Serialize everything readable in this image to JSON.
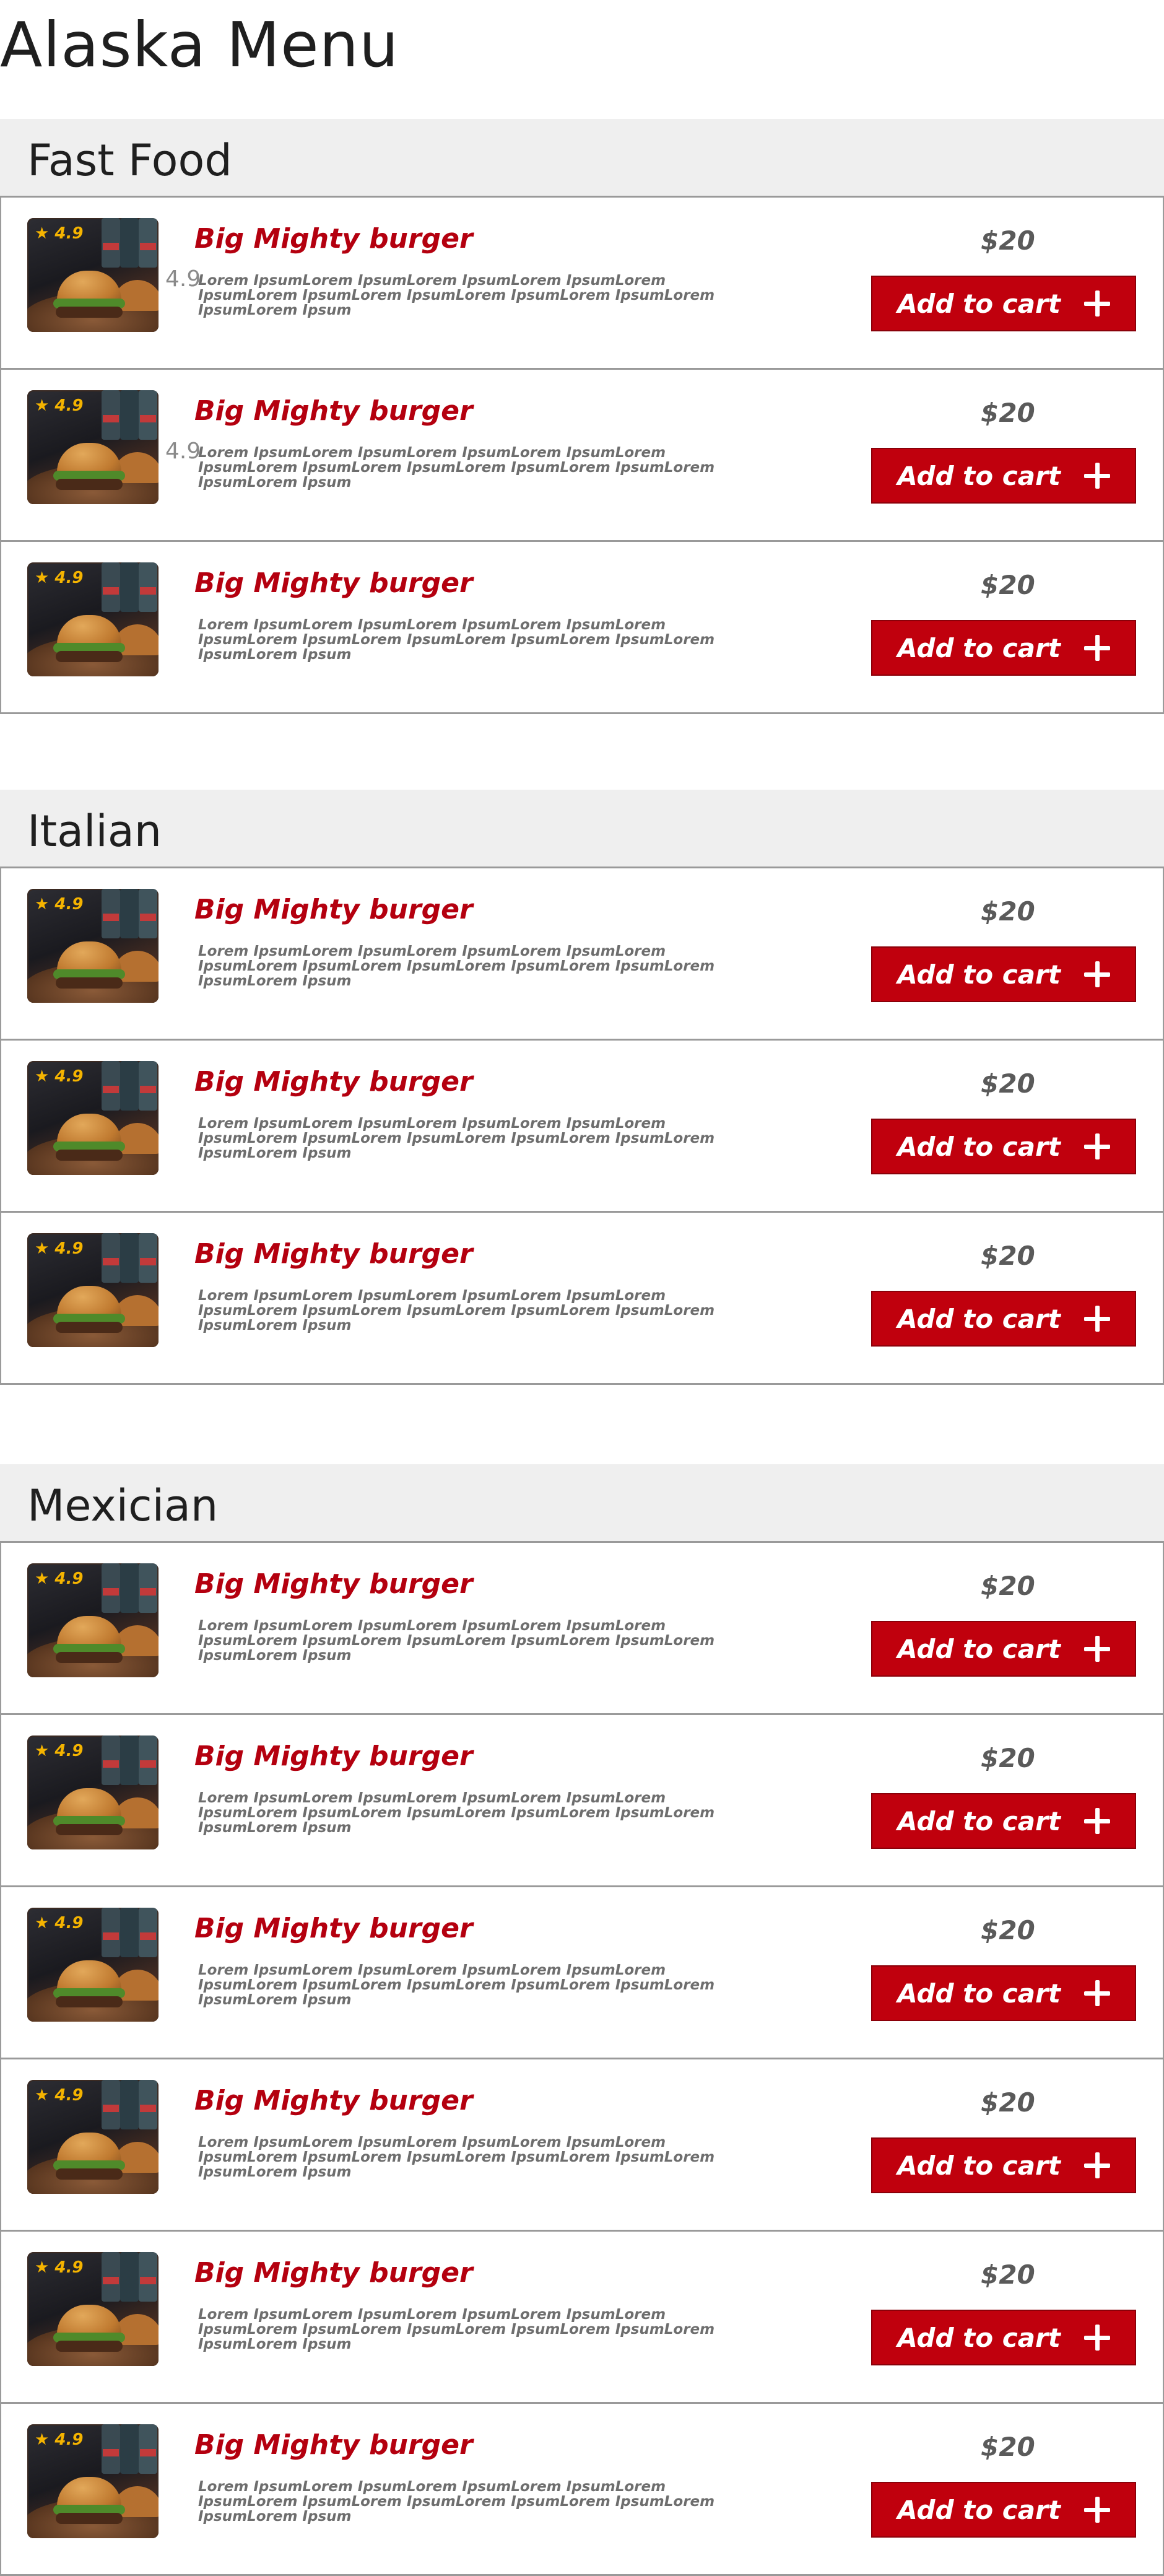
{
  "page": {
    "title": "Alaska Menu"
  },
  "colors": {
    "accent": "#c0000d",
    "name": "#b4000f",
    "rating": "#f5b400",
    "section_bg": "#efefef"
  },
  "sections": [
    {
      "title": "Fast Food",
      "items": [
        {
          "rating": "4.9",
          "extra_rating": "4.9",
          "name": "Big Mighty burger",
          "description": "Lorem IpsumLorem IpsumLorem IpsumLorem IpsumLorem IpsumLorem IpsumLorem IpsumLorem IpsumLorem IpsumLorem IpsumLorem Ipsum",
          "price": "$20",
          "button": "Add to cart",
          "image": "burger-photo"
        },
        {
          "rating": "4.9",
          "extra_rating": "4.9",
          "name": "Big Mighty burger",
          "description": "Lorem IpsumLorem IpsumLorem IpsumLorem IpsumLorem IpsumLorem IpsumLorem IpsumLorem IpsumLorem IpsumLorem IpsumLorem Ipsum",
          "price": "$20",
          "button": "Add to cart",
          "image": "burger-photo"
        },
        {
          "rating": "4.9",
          "name": "Big Mighty burger",
          "description": "Lorem IpsumLorem IpsumLorem IpsumLorem IpsumLorem IpsumLorem IpsumLorem IpsumLorem IpsumLorem IpsumLorem IpsumLorem Ipsum",
          "price": "$20",
          "button": "Add to cart",
          "image": "burger-photo"
        }
      ]
    },
    {
      "title": "Italian",
      "items": [
        {
          "rating": "4.9",
          "name": "Big Mighty burger",
          "description": "Lorem IpsumLorem IpsumLorem IpsumLorem IpsumLorem IpsumLorem IpsumLorem IpsumLorem IpsumLorem IpsumLorem IpsumLorem Ipsum",
          "price": "$20",
          "button": "Add to cart",
          "image": "burger-photo"
        },
        {
          "rating": "4.9",
          "name": "Big Mighty burger",
          "description": "Lorem IpsumLorem IpsumLorem IpsumLorem IpsumLorem IpsumLorem IpsumLorem IpsumLorem IpsumLorem IpsumLorem IpsumLorem Ipsum",
          "price": "$20",
          "button": "Add to cart",
          "image": "burger-photo"
        },
        {
          "rating": "4.9",
          "name": "Big Mighty burger",
          "description": "Lorem IpsumLorem IpsumLorem IpsumLorem IpsumLorem IpsumLorem IpsumLorem IpsumLorem IpsumLorem IpsumLorem IpsumLorem Ipsum",
          "price": "$20",
          "button": "Add to cart",
          "image": "burger-photo"
        }
      ]
    },
    {
      "title": "Mexician",
      "items": [
        {
          "rating": "4.9",
          "name": "Big Mighty burger",
          "description": "Lorem IpsumLorem IpsumLorem IpsumLorem IpsumLorem IpsumLorem IpsumLorem IpsumLorem IpsumLorem IpsumLorem IpsumLorem Ipsum",
          "price": "$20",
          "button": "Add to cart",
          "image": "burger-photo"
        },
        {
          "rating": "4.9",
          "name": "Big Mighty burger",
          "description": "Lorem IpsumLorem IpsumLorem IpsumLorem IpsumLorem IpsumLorem IpsumLorem IpsumLorem IpsumLorem IpsumLorem IpsumLorem Ipsum",
          "price": "$20",
          "button": "Add to cart",
          "image": "burger-photo"
        },
        {
          "rating": "4.9",
          "name": "Big Mighty burger",
          "description": "Lorem IpsumLorem IpsumLorem IpsumLorem IpsumLorem IpsumLorem IpsumLorem IpsumLorem IpsumLorem IpsumLorem IpsumLorem Ipsum",
          "price": "$20",
          "button": "Add to cart",
          "image": "burger-photo"
        },
        {
          "rating": "4.9",
          "name": "Big Mighty burger",
          "description": "Lorem IpsumLorem IpsumLorem IpsumLorem IpsumLorem IpsumLorem IpsumLorem IpsumLorem IpsumLorem IpsumLorem IpsumLorem Ipsum",
          "price": "$20",
          "button": "Add to cart",
          "image": "burger-photo"
        },
        {
          "rating": "4.9",
          "name": "Big Mighty burger",
          "description": "Lorem IpsumLorem IpsumLorem IpsumLorem IpsumLorem IpsumLorem IpsumLorem IpsumLorem IpsumLorem IpsumLorem IpsumLorem Ipsum",
          "price": "$20",
          "button": "Add to cart",
          "image": "burger-photo"
        },
        {
          "rating": "4.9",
          "name": "Big Mighty burger",
          "description": "Lorem IpsumLorem IpsumLorem IpsumLorem IpsumLorem IpsumLorem IpsumLorem IpsumLorem IpsumLorem IpsumLorem IpsumLorem Ipsum",
          "price": "$20",
          "button": "Add to cart",
          "image": "burger-photo"
        }
      ]
    }
  ]
}
